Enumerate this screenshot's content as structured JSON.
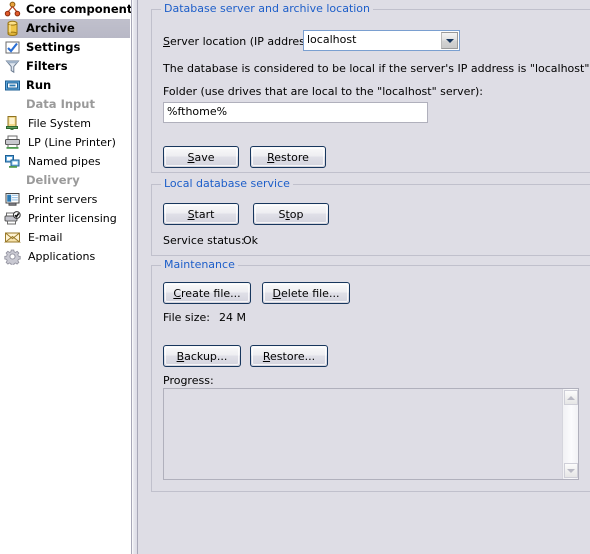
{
  "sidebar": {
    "top_items": [
      {
        "label": "Core components",
        "icon": "core-components-icon",
        "selected": false
      },
      {
        "label": "Archive",
        "icon": "archive-database-icon",
        "selected": true
      },
      {
        "label": "Settings",
        "icon": "settings-checkmark-icon",
        "selected": false
      },
      {
        "label": "Filters",
        "icon": "filter-funnel-icon",
        "selected": false
      },
      {
        "label": "Run",
        "icon": "run-icon",
        "selected": false
      }
    ],
    "groups": [
      {
        "header": "Data Input",
        "items": [
          {
            "label": "File System",
            "icon": "file-system-icon"
          },
          {
            "label": "LP (Line Printer)",
            "icon": "line-printer-icon"
          },
          {
            "label": "Named pipes",
            "icon": "named-pipes-icon"
          }
        ]
      },
      {
        "header": "Delivery",
        "items": [
          {
            "label": "Print servers",
            "icon": "print-servers-icon"
          },
          {
            "label": "Printer licensing",
            "icon": "printer-licensing-icon"
          },
          {
            "label": "E-mail",
            "icon": "email-envelope-icon"
          },
          {
            "label": "Applications",
            "icon": "applications-gear-icon"
          }
        ]
      }
    ]
  },
  "colors": {
    "group_title": "#1d5ec9",
    "panel_bg": "#dedde5",
    "selection": "#b8b8c6",
    "button_border": "#17365d"
  },
  "database_group": {
    "title": "Database server and archive location",
    "server_location_label": "Server location (IP address):",
    "server_location_accesskey": "S",
    "server_location_value": "localhost",
    "server_location_options": [
      "localhost"
    ],
    "hint_text": "The database is considered to be local if the server's IP address is \"localhost\"",
    "folder_label": "Folder (use drives that are local to the \"localhost\" server):",
    "folder_value": "%fthome%",
    "save_button": "Save",
    "save_accesskey": "S",
    "restore_button": "Restore",
    "restore_accesskey": "R"
  },
  "service_group": {
    "title": "Local database service",
    "start_button": "Start",
    "start_accesskey": "S",
    "stop_button": "Stop",
    "stop_accesskey": "t",
    "status_label": "Service status:",
    "status_value": "Ok"
  },
  "maintenance_group": {
    "title": "Maintenance",
    "create_button": "Create file...",
    "create_accesskey": "C",
    "delete_button": "Delete file...",
    "delete_accesskey": "D",
    "filesize_label": "File size:",
    "filesize_value": "24 M",
    "backup_button": "Backup...",
    "backup_accesskey": "B",
    "restore_button": "Restore...",
    "restore_accesskey": "R",
    "progress_label": "Progress:",
    "progress_content": ""
  }
}
